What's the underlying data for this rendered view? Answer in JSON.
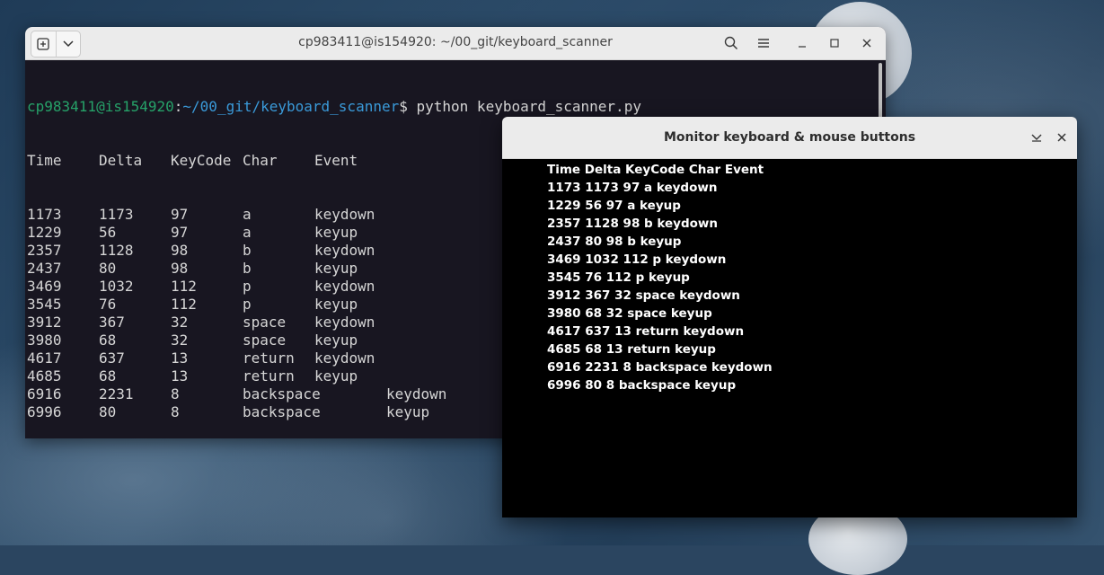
{
  "terminal": {
    "title": "cp983411@is154920: ~/00_git/keyboard_scanner",
    "prompt_user": "cp983411@is154920",
    "prompt_sep": ":",
    "prompt_path": "~/00_git/keyboard_scanner",
    "prompt_symbol": "$ ",
    "command": "python keyboard_scanner.py",
    "header": {
      "time": "Time",
      "delta": "Delta",
      "code": "KeyCode",
      "char": "Char",
      "event": "Event"
    },
    "rows": [
      {
        "time": "1173",
        "delta": "1173",
        "code": "97",
        "char": "a",
        "event": "keydown"
      },
      {
        "time": "1229",
        "delta": "56",
        "code": "97",
        "char": "a",
        "event": "keyup"
      },
      {
        "time": "2357",
        "delta": "1128",
        "code": "98",
        "char": "b",
        "event": "keydown"
      },
      {
        "time": "2437",
        "delta": "80",
        "code": "98",
        "char": "b",
        "event": "keyup"
      },
      {
        "time": "3469",
        "delta": "1032",
        "code": "112",
        "char": "p",
        "event": "keydown"
      },
      {
        "time": "3545",
        "delta": "76",
        "code": "112",
        "char": "p",
        "event": "keyup"
      },
      {
        "time": "3912",
        "delta": "367",
        "code": "32",
        "char": "space",
        "event": "keydown"
      },
      {
        "time": "3980",
        "delta": "68",
        "code": "32",
        "char": "space",
        "event": "keyup"
      },
      {
        "time": "4617",
        "delta": "637",
        "code": "13",
        "char": "return",
        "event": "keydown"
      },
      {
        "time": "4685",
        "delta": "68",
        "code": "13",
        "char": "return",
        "event": "keyup"
      },
      {
        "time": "6916",
        "delta": "2231",
        "code": "8",
        "char": "backspace",
        "event": "keydown"
      },
      {
        "time": "6996",
        "delta": "80",
        "code": "8",
        "char": "backspace",
        "event": "keyup"
      }
    ],
    "icons": {
      "new_tab": "new-tab-icon",
      "dropdown": "chevron-down-icon",
      "search": "search-icon",
      "menu": "hamburger-menu-icon",
      "minimize": "minimize-icon",
      "maximize": "maximize-icon",
      "close": "close-icon"
    },
    "colors": {
      "background": "#181621",
      "text": "#d6d6d6",
      "prompt_user": "#26a269",
      "prompt_path": "#3a9ad9"
    }
  },
  "monitor": {
    "title": "Monitor keyboard & mouse buttons",
    "lines": [
      "Time Delta KeyCode Char Event",
      "1173 1173 97 a keydown",
      "1229 56 97 a keyup",
      "2357 1128 98 b keydown",
      "2437 80 98 b keyup",
      "3469 1032 112 p keydown",
      "3545 76 112 p keyup",
      "3912 367 32 space keydown",
      "3980 68 32 space keyup",
      "4617 637 13 return keydown",
      "4685 68 13 return keyup",
      "6916 2231 8 backspace keydown",
      "6996 80 8 backspace keyup"
    ],
    "icons": {
      "minimize": "minimize-chevron-icon",
      "close": "close-icon"
    }
  }
}
